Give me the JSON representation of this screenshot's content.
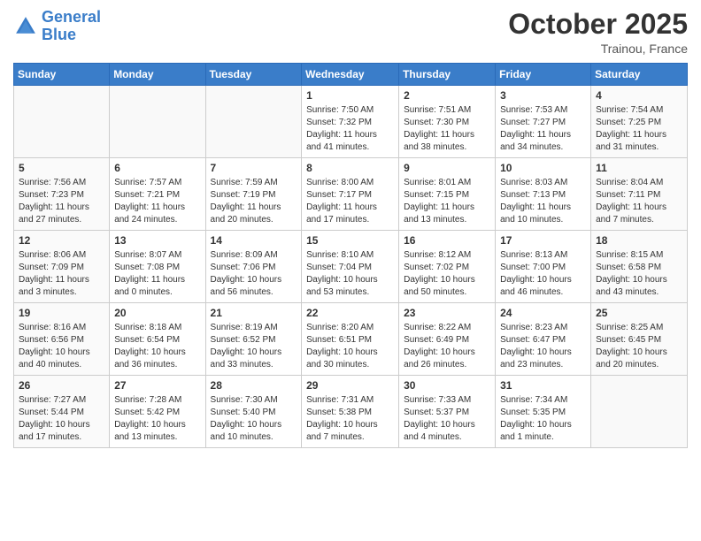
{
  "header": {
    "logo_line1": "General",
    "logo_line2": "Blue",
    "month": "October 2025",
    "location": "Trainou, France"
  },
  "weekdays": [
    "Sunday",
    "Monday",
    "Tuesday",
    "Wednesday",
    "Thursday",
    "Friday",
    "Saturday"
  ],
  "weeks": [
    [
      {
        "day": "",
        "info": ""
      },
      {
        "day": "",
        "info": ""
      },
      {
        "day": "",
        "info": ""
      },
      {
        "day": "1",
        "info": "Sunrise: 7:50 AM\nSunset: 7:32 PM\nDaylight: 11 hours\nand 41 minutes."
      },
      {
        "day": "2",
        "info": "Sunrise: 7:51 AM\nSunset: 7:30 PM\nDaylight: 11 hours\nand 38 minutes."
      },
      {
        "day": "3",
        "info": "Sunrise: 7:53 AM\nSunset: 7:27 PM\nDaylight: 11 hours\nand 34 minutes."
      },
      {
        "day": "4",
        "info": "Sunrise: 7:54 AM\nSunset: 7:25 PM\nDaylight: 11 hours\nand 31 minutes."
      }
    ],
    [
      {
        "day": "5",
        "info": "Sunrise: 7:56 AM\nSunset: 7:23 PM\nDaylight: 11 hours\nand 27 minutes."
      },
      {
        "day": "6",
        "info": "Sunrise: 7:57 AM\nSunset: 7:21 PM\nDaylight: 11 hours\nand 24 minutes."
      },
      {
        "day": "7",
        "info": "Sunrise: 7:59 AM\nSunset: 7:19 PM\nDaylight: 11 hours\nand 20 minutes."
      },
      {
        "day": "8",
        "info": "Sunrise: 8:00 AM\nSunset: 7:17 PM\nDaylight: 11 hours\nand 17 minutes."
      },
      {
        "day": "9",
        "info": "Sunrise: 8:01 AM\nSunset: 7:15 PM\nDaylight: 11 hours\nand 13 minutes."
      },
      {
        "day": "10",
        "info": "Sunrise: 8:03 AM\nSunset: 7:13 PM\nDaylight: 11 hours\nand 10 minutes."
      },
      {
        "day": "11",
        "info": "Sunrise: 8:04 AM\nSunset: 7:11 PM\nDaylight: 11 hours\nand 7 minutes."
      }
    ],
    [
      {
        "day": "12",
        "info": "Sunrise: 8:06 AM\nSunset: 7:09 PM\nDaylight: 11 hours\nand 3 minutes."
      },
      {
        "day": "13",
        "info": "Sunrise: 8:07 AM\nSunset: 7:08 PM\nDaylight: 11 hours\nand 0 minutes."
      },
      {
        "day": "14",
        "info": "Sunrise: 8:09 AM\nSunset: 7:06 PM\nDaylight: 10 hours\nand 56 minutes."
      },
      {
        "day": "15",
        "info": "Sunrise: 8:10 AM\nSunset: 7:04 PM\nDaylight: 10 hours\nand 53 minutes."
      },
      {
        "day": "16",
        "info": "Sunrise: 8:12 AM\nSunset: 7:02 PM\nDaylight: 10 hours\nand 50 minutes."
      },
      {
        "day": "17",
        "info": "Sunrise: 8:13 AM\nSunset: 7:00 PM\nDaylight: 10 hours\nand 46 minutes."
      },
      {
        "day": "18",
        "info": "Sunrise: 8:15 AM\nSunset: 6:58 PM\nDaylight: 10 hours\nand 43 minutes."
      }
    ],
    [
      {
        "day": "19",
        "info": "Sunrise: 8:16 AM\nSunset: 6:56 PM\nDaylight: 10 hours\nand 40 minutes."
      },
      {
        "day": "20",
        "info": "Sunrise: 8:18 AM\nSunset: 6:54 PM\nDaylight: 10 hours\nand 36 minutes."
      },
      {
        "day": "21",
        "info": "Sunrise: 8:19 AM\nSunset: 6:52 PM\nDaylight: 10 hours\nand 33 minutes."
      },
      {
        "day": "22",
        "info": "Sunrise: 8:20 AM\nSunset: 6:51 PM\nDaylight: 10 hours\nand 30 minutes."
      },
      {
        "day": "23",
        "info": "Sunrise: 8:22 AM\nSunset: 6:49 PM\nDaylight: 10 hours\nand 26 minutes."
      },
      {
        "day": "24",
        "info": "Sunrise: 8:23 AM\nSunset: 6:47 PM\nDaylight: 10 hours\nand 23 minutes."
      },
      {
        "day": "25",
        "info": "Sunrise: 8:25 AM\nSunset: 6:45 PM\nDaylight: 10 hours\nand 20 minutes."
      }
    ],
    [
      {
        "day": "26",
        "info": "Sunrise: 7:27 AM\nSunset: 5:44 PM\nDaylight: 10 hours\nand 17 minutes."
      },
      {
        "day": "27",
        "info": "Sunrise: 7:28 AM\nSunset: 5:42 PM\nDaylight: 10 hours\nand 13 minutes."
      },
      {
        "day": "28",
        "info": "Sunrise: 7:30 AM\nSunset: 5:40 PM\nDaylight: 10 hours\nand 10 minutes."
      },
      {
        "day": "29",
        "info": "Sunrise: 7:31 AM\nSunset: 5:38 PM\nDaylight: 10 hours\nand 7 minutes."
      },
      {
        "day": "30",
        "info": "Sunrise: 7:33 AM\nSunset: 5:37 PM\nDaylight: 10 hours\nand 4 minutes."
      },
      {
        "day": "31",
        "info": "Sunrise: 7:34 AM\nSunset: 5:35 PM\nDaylight: 10 hours\nand 1 minute."
      },
      {
        "day": "",
        "info": ""
      }
    ]
  ]
}
